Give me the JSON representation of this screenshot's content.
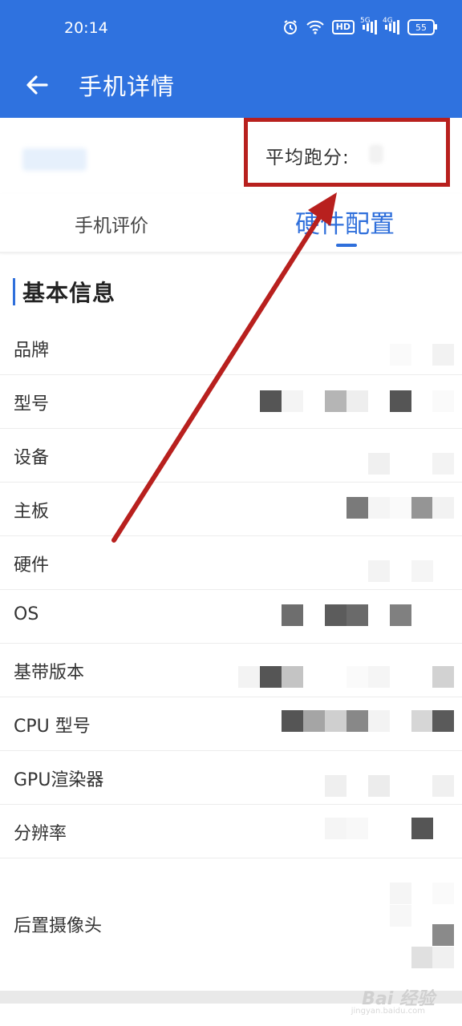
{
  "status_bar": {
    "time": "20:14",
    "hd_label": "HD",
    "net1_label": "5G",
    "net2_label": "4G",
    "battery": "55"
  },
  "app_bar": {
    "title": "手机详情"
  },
  "score": {
    "label": "平均跑分:"
  },
  "tabs": [
    {
      "label": "手机评价",
      "active": false
    },
    {
      "label": "硬件配置",
      "active": true
    }
  ],
  "section": {
    "title": "基本信息"
  },
  "rows": [
    {
      "label": "品牌"
    },
    {
      "label": "型号"
    },
    {
      "label": "设备"
    },
    {
      "label": "主板"
    },
    {
      "label": "硬件"
    },
    {
      "label": "OS"
    },
    {
      "label": "基带版本"
    },
    {
      "label": "CPU 型号"
    },
    {
      "label": "GPU渲染器"
    },
    {
      "label": "分辨率"
    },
    {
      "label": "后置摄像头"
    }
  ],
  "watermark": {
    "brand": "Bai 经验",
    "url": "jingyan.baidu.com"
  },
  "colors": {
    "primary": "#2f72df",
    "accent_text": "#2f6fdb",
    "highlight": "#b8201e"
  }
}
